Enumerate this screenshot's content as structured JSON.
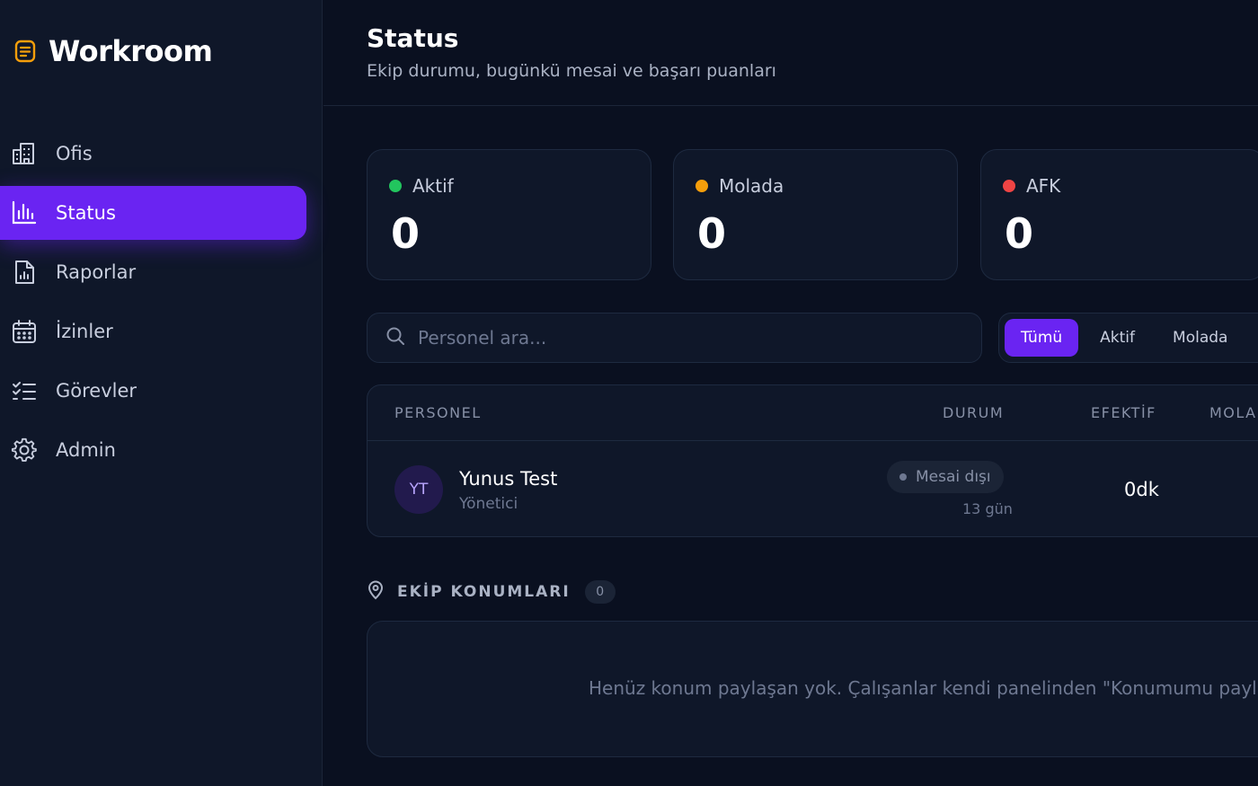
{
  "app": {
    "name": "Workroom"
  },
  "sidebar": {
    "items": [
      {
        "label": "Ofis",
        "icon": "building-icon",
        "active": false
      },
      {
        "label": "Status",
        "icon": "bar-chart-icon",
        "active": true
      },
      {
        "label": "Raporlar",
        "icon": "report-file-icon",
        "active": false
      },
      {
        "label": "İzinler",
        "icon": "calendar-icon",
        "active": false
      },
      {
        "label": "Görevler",
        "icon": "checklist-icon",
        "active": false
      },
      {
        "label": "Admin",
        "icon": "gear-icon",
        "active": false
      }
    ]
  },
  "header": {
    "title": "Status",
    "subtitle": "Ekip durumu, bugünkü mesai ve başarı puanları"
  },
  "stats": [
    {
      "label": "Aktif",
      "value": "0",
      "color": "#22c55e"
    },
    {
      "label": "Molada",
      "value": "0",
      "color": "#f59e0b"
    },
    {
      "label": "AFK",
      "value": "0",
      "color": "#ef4444"
    }
  ],
  "search": {
    "placeholder": "Personel ara..."
  },
  "filters": [
    {
      "label": "Tümü",
      "active": true
    },
    {
      "label": "Aktif",
      "active": false
    },
    {
      "label": "Molada",
      "active": false
    }
  ],
  "table": {
    "headers": {
      "personel": "PERSONEL",
      "durum": "DURUM",
      "efektif": "EFEKTİF",
      "mola": "MOLA"
    },
    "rows": [
      {
        "initials": "YT",
        "name": "Yunus Test",
        "role": "Yönetici",
        "status": "Mesai dışı",
        "days": "13 gün",
        "effective": "0dk"
      }
    ]
  },
  "locations": {
    "title": "EKİP KONUMLARI",
    "count": "0",
    "empty_text": "Henüz konum paylaşan yok. Çalışanlar kendi panelinden \"Konumumu payla"
  },
  "colors": {
    "accent": "#6a24f2",
    "background": "#0a1020",
    "panel": "#0f1729",
    "brand_icon": "#f59e0b"
  }
}
